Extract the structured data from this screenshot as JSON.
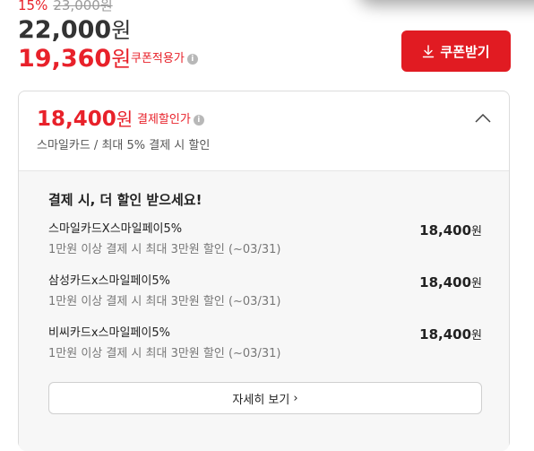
{
  "price": {
    "discount_rate": "15%",
    "original": "23,000원",
    "sale_amount": "22,000",
    "coupon_amount": "19,360",
    "unit": "원",
    "coupon_label": "쿠폰적용가",
    "info_icon": "i"
  },
  "coupon_button": {
    "label": "쿠폰받기",
    "icon": "download-icon"
  },
  "payment_discount": {
    "amount": "18,400",
    "unit": "원",
    "label": "결제할인가",
    "info_icon": "i",
    "subtitle": "스마일카드 / 최대 5% 결제 시 할인",
    "title": "결제 시, 더 할인 받으세요!",
    "offers": [
      {
        "name": "스마일카드X스마일페이5%",
        "condition": "1만원 이상 결제 시 최대 3만원 할인 (~03/31)",
        "amount": "18,400",
        "unit": "원"
      },
      {
        "name": "삼성카드x스마일페이5%",
        "condition": "1만원 이상 결제 시 최대 3만원 할인 (~03/31)",
        "amount": "18,400",
        "unit": "원"
      },
      {
        "name": "비씨카드x스마일페이5%",
        "condition": "1만원 이상 결제 시 최대 3만원 할인 (~03/31)",
        "amount": "18,400",
        "unit": "원"
      }
    ],
    "more_button": "자세히 보기",
    "more_chevron": "›"
  },
  "colors": {
    "accent": "#e8212a",
    "button": "#e11b22"
  }
}
